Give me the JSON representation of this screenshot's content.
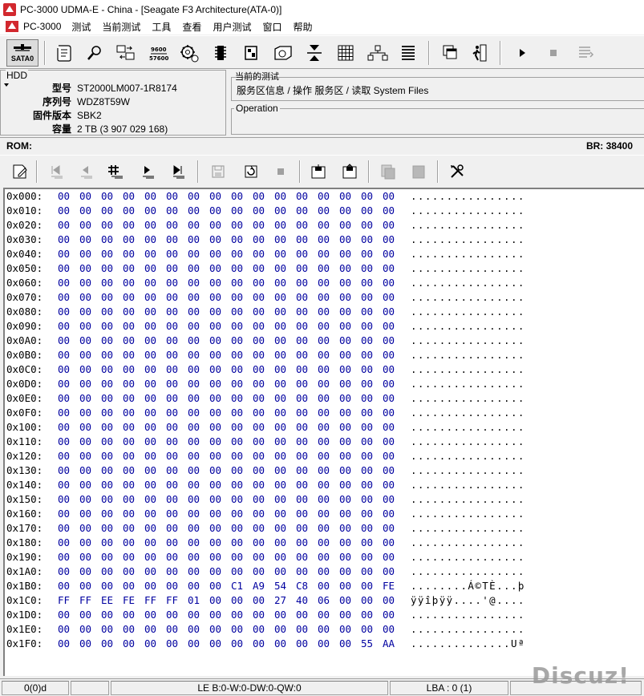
{
  "window": {
    "title": "PC-3000 UDMA-E - China - [Seagate F3 Architecture(ATA-0)]"
  },
  "menu": {
    "logo_label": "PC-3000",
    "items": [
      "测试",
      "当前测试",
      "工具",
      "查看",
      "用户测试",
      "窗口",
      "帮助"
    ]
  },
  "toolbar": {
    "sata_label": "SATA0",
    "buttons": [
      {
        "name": "script-icon"
      },
      {
        "name": "search-icon"
      },
      {
        "name": "transfer-icon"
      },
      {
        "name": "baud-9600-icon"
      },
      {
        "name": "gear-settings-icon"
      },
      {
        "name": "chip-icon"
      },
      {
        "name": "board-icon"
      },
      {
        "name": "disk-icon"
      },
      {
        "name": "head-icon"
      },
      {
        "name": "grid-icon"
      },
      {
        "name": "network-icon"
      },
      {
        "name": "list-icon"
      },
      {
        "name": "windows-icon"
      },
      {
        "name": "exit-icon"
      },
      {
        "name": "play-icon"
      },
      {
        "name": "stop-icon"
      },
      {
        "name": "log-icon"
      }
    ]
  },
  "hdd": {
    "legend": "HDD",
    "rows": [
      {
        "key": "型号",
        "value": "ST2000LM007-1R8174"
      },
      {
        "key": "序列号",
        "value": "WDZ8T59W"
      },
      {
        "key": "固件版本",
        "value": "SBK2"
      },
      {
        "key": "容量",
        "value": "2 TB (3 907 029 168)"
      }
    ]
  },
  "current_test": {
    "legend": "当前的测试",
    "path": "服务区信息 / 操作 服务区 / 读取 System Files"
  },
  "operation": {
    "legend": "Operation"
  },
  "rom_bar": {
    "rom_label": "ROM:",
    "br_label": "BR: 38400"
  },
  "hex": {
    "rows": [
      {
        "addr": "0x000:",
        "bytes": [
          "00",
          "00",
          "00",
          "00",
          "00",
          "00",
          "00",
          "00",
          "00",
          "00",
          "00",
          "00",
          "00",
          "00",
          "00",
          "00"
        ],
        "ascii": "................"
      },
      {
        "addr": "0x010:",
        "bytes": [
          "00",
          "00",
          "00",
          "00",
          "00",
          "00",
          "00",
          "00",
          "00",
          "00",
          "00",
          "00",
          "00",
          "00",
          "00",
          "00"
        ],
        "ascii": "................"
      },
      {
        "addr": "0x020:",
        "bytes": [
          "00",
          "00",
          "00",
          "00",
          "00",
          "00",
          "00",
          "00",
          "00",
          "00",
          "00",
          "00",
          "00",
          "00",
          "00",
          "00"
        ],
        "ascii": "................"
      },
      {
        "addr": "0x030:",
        "bytes": [
          "00",
          "00",
          "00",
          "00",
          "00",
          "00",
          "00",
          "00",
          "00",
          "00",
          "00",
          "00",
          "00",
          "00",
          "00",
          "00"
        ],
        "ascii": "................"
      },
      {
        "addr": "0x040:",
        "bytes": [
          "00",
          "00",
          "00",
          "00",
          "00",
          "00",
          "00",
          "00",
          "00",
          "00",
          "00",
          "00",
          "00",
          "00",
          "00",
          "00"
        ],
        "ascii": "................"
      },
      {
        "addr": "0x050:",
        "bytes": [
          "00",
          "00",
          "00",
          "00",
          "00",
          "00",
          "00",
          "00",
          "00",
          "00",
          "00",
          "00",
          "00",
          "00",
          "00",
          "00"
        ],
        "ascii": "................"
      },
      {
        "addr": "0x060:",
        "bytes": [
          "00",
          "00",
          "00",
          "00",
          "00",
          "00",
          "00",
          "00",
          "00",
          "00",
          "00",
          "00",
          "00",
          "00",
          "00",
          "00"
        ],
        "ascii": "................"
      },
      {
        "addr": "0x070:",
        "bytes": [
          "00",
          "00",
          "00",
          "00",
          "00",
          "00",
          "00",
          "00",
          "00",
          "00",
          "00",
          "00",
          "00",
          "00",
          "00",
          "00"
        ],
        "ascii": "................"
      },
      {
        "addr": "0x080:",
        "bytes": [
          "00",
          "00",
          "00",
          "00",
          "00",
          "00",
          "00",
          "00",
          "00",
          "00",
          "00",
          "00",
          "00",
          "00",
          "00",
          "00"
        ],
        "ascii": "................"
      },
      {
        "addr": "0x090:",
        "bytes": [
          "00",
          "00",
          "00",
          "00",
          "00",
          "00",
          "00",
          "00",
          "00",
          "00",
          "00",
          "00",
          "00",
          "00",
          "00",
          "00"
        ],
        "ascii": "................"
      },
      {
        "addr": "0x0A0:",
        "bytes": [
          "00",
          "00",
          "00",
          "00",
          "00",
          "00",
          "00",
          "00",
          "00",
          "00",
          "00",
          "00",
          "00",
          "00",
          "00",
          "00"
        ],
        "ascii": "................"
      },
      {
        "addr": "0x0B0:",
        "bytes": [
          "00",
          "00",
          "00",
          "00",
          "00",
          "00",
          "00",
          "00",
          "00",
          "00",
          "00",
          "00",
          "00",
          "00",
          "00",
          "00"
        ],
        "ascii": "................"
      },
      {
        "addr": "0x0C0:",
        "bytes": [
          "00",
          "00",
          "00",
          "00",
          "00",
          "00",
          "00",
          "00",
          "00",
          "00",
          "00",
          "00",
          "00",
          "00",
          "00",
          "00"
        ],
        "ascii": "................"
      },
      {
        "addr": "0x0D0:",
        "bytes": [
          "00",
          "00",
          "00",
          "00",
          "00",
          "00",
          "00",
          "00",
          "00",
          "00",
          "00",
          "00",
          "00",
          "00",
          "00",
          "00"
        ],
        "ascii": "................"
      },
      {
        "addr": "0x0E0:",
        "bytes": [
          "00",
          "00",
          "00",
          "00",
          "00",
          "00",
          "00",
          "00",
          "00",
          "00",
          "00",
          "00",
          "00",
          "00",
          "00",
          "00"
        ],
        "ascii": "................"
      },
      {
        "addr": "0x0F0:",
        "bytes": [
          "00",
          "00",
          "00",
          "00",
          "00",
          "00",
          "00",
          "00",
          "00",
          "00",
          "00",
          "00",
          "00",
          "00",
          "00",
          "00"
        ],
        "ascii": "................"
      },
      {
        "addr": "0x100:",
        "bytes": [
          "00",
          "00",
          "00",
          "00",
          "00",
          "00",
          "00",
          "00",
          "00",
          "00",
          "00",
          "00",
          "00",
          "00",
          "00",
          "00"
        ],
        "ascii": "................"
      },
      {
        "addr": "0x110:",
        "bytes": [
          "00",
          "00",
          "00",
          "00",
          "00",
          "00",
          "00",
          "00",
          "00",
          "00",
          "00",
          "00",
          "00",
          "00",
          "00",
          "00"
        ],
        "ascii": "................"
      },
      {
        "addr": "0x120:",
        "bytes": [
          "00",
          "00",
          "00",
          "00",
          "00",
          "00",
          "00",
          "00",
          "00",
          "00",
          "00",
          "00",
          "00",
          "00",
          "00",
          "00"
        ],
        "ascii": "................"
      },
      {
        "addr": "0x130:",
        "bytes": [
          "00",
          "00",
          "00",
          "00",
          "00",
          "00",
          "00",
          "00",
          "00",
          "00",
          "00",
          "00",
          "00",
          "00",
          "00",
          "00"
        ],
        "ascii": "................"
      },
      {
        "addr": "0x140:",
        "bytes": [
          "00",
          "00",
          "00",
          "00",
          "00",
          "00",
          "00",
          "00",
          "00",
          "00",
          "00",
          "00",
          "00",
          "00",
          "00",
          "00"
        ],
        "ascii": "................"
      },
      {
        "addr": "0x150:",
        "bytes": [
          "00",
          "00",
          "00",
          "00",
          "00",
          "00",
          "00",
          "00",
          "00",
          "00",
          "00",
          "00",
          "00",
          "00",
          "00",
          "00"
        ],
        "ascii": "................"
      },
      {
        "addr": "0x160:",
        "bytes": [
          "00",
          "00",
          "00",
          "00",
          "00",
          "00",
          "00",
          "00",
          "00",
          "00",
          "00",
          "00",
          "00",
          "00",
          "00",
          "00"
        ],
        "ascii": "................"
      },
      {
        "addr": "0x170:",
        "bytes": [
          "00",
          "00",
          "00",
          "00",
          "00",
          "00",
          "00",
          "00",
          "00",
          "00",
          "00",
          "00",
          "00",
          "00",
          "00",
          "00"
        ],
        "ascii": "................"
      },
      {
        "addr": "0x180:",
        "bytes": [
          "00",
          "00",
          "00",
          "00",
          "00",
          "00",
          "00",
          "00",
          "00",
          "00",
          "00",
          "00",
          "00",
          "00",
          "00",
          "00"
        ],
        "ascii": "................"
      },
      {
        "addr": "0x190:",
        "bytes": [
          "00",
          "00",
          "00",
          "00",
          "00",
          "00",
          "00",
          "00",
          "00",
          "00",
          "00",
          "00",
          "00",
          "00",
          "00",
          "00"
        ],
        "ascii": "................"
      },
      {
        "addr": "0x1A0:",
        "bytes": [
          "00",
          "00",
          "00",
          "00",
          "00",
          "00",
          "00",
          "00",
          "00",
          "00",
          "00",
          "00",
          "00",
          "00",
          "00",
          "00"
        ],
        "ascii": "................"
      },
      {
        "addr": "0x1B0:",
        "bytes": [
          "00",
          "00",
          "00",
          "00",
          "00",
          "00",
          "00",
          "00",
          "C1",
          "A9",
          "54",
          "C8",
          "00",
          "00",
          "00",
          "FE"
        ],
        "ascii": "........Á©TÈ...þ"
      },
      {
        "addr": "0x1C0:",
        "bytes": [
          "FF",
          "FF",
          "EE",
          "FE",
          "FF",
          "FF",
          "01",
          "00",
          "00",
          "00",
          "27",
          "40",
          "06",
          "00",
          "00",
          "00"
        ],
        "ascii": "ÿÿîþÿÿ....'@...."
      },
      {
        "addr": "0x1D0:",
        "bytes": [
          "00",
          "00",
          "00",
          "00",
          "00",
          "00",
          "00",
          "00",
          "00",
          "00",
          "00",
          "00",
          "00",
          "00",
          "00",
          "00"
        ],
        "ascii": "................"
      },
      {
        "addr": "0x1E0:",
        "bytes": [
          "00",
          "00",
          "00",
          "00",
          "00",
          "00",
          "00",
          "00",
          "00",
          "00",
          "00",
          "00",
          "00",
          "00",
          "00",
          "00"
        ],
        "ascii": "................"
      },
      {
        "addr": "0x1F0:",
        "bytes": [
          "00",
          "00",
          "00",
          "00",
          "00",
          "00",
          "00",
          "00",
          "00",
          "00",
          "00",
          "00",
          "00",
          "00",
          "55",
          "AA"
        ],
        "ascii": "..............Uª"
      }
    ]
  },
  "statusbar": {
    "cells": [
      "0(0)d",
      "",
      "LE B:0-W:0-DW:0-QW:0",
      "LBA : 0 (1)",
      ""
    ]
  },
  "watermark": "Discuz!"
}
